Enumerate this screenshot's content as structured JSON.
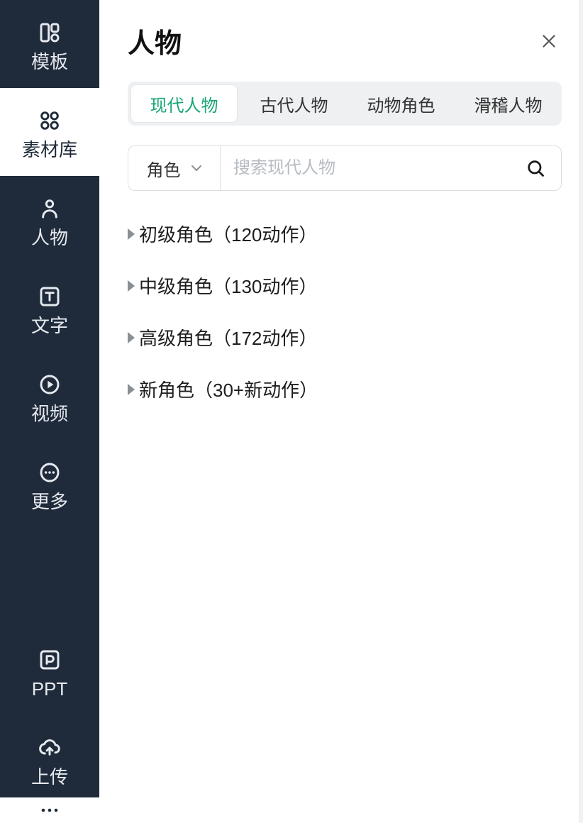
{
  "sidebar": {
    "items": [
      {
        "label": "模板",
        "icon": "template-icon"
      },
      {
        "label": "素材库",
        "icon": "assets-icon",
        "active": true
      },
      {
        "label": "人物",
        "icon": "character-icon"
      },
      {
        "label": "文字",
        "icon": "text-icon"
      },
      {
        "label": "视频",
        "icon": "video-icon"
      },
      {
        "label": "更多",
        "icon": "more-icon"
      },
      {
        "label": "PPT",
        "icon": "ppt-icon"
      },
      {
        "label": "上传",
        "icon": "upload-icon"
      }
    ]
  },
  "panel": {
    "title": "人物",
    "tabs": [
      {
        "label": "现代人物",
        "active": true
      },
      {
        "label": "古代人物"
      },
      {
        "label": "动物角色"
      },
      {
        "label": "滑稽人物"
      }
    ],
    "filter": {
      "label": "角色"
    },
    "search": {
      "placeholder": "搜索现代人物"
    },
    "categories": [
      {
        "label": "初级角色（120动作）"
      },
      {
        "label": "中级角色（130动作）"
      },
      {
        "label": "高级角色（172动作）"
      },
      {
        "label": "新角色（30+新动作）"
      }
    ]
  }
}
